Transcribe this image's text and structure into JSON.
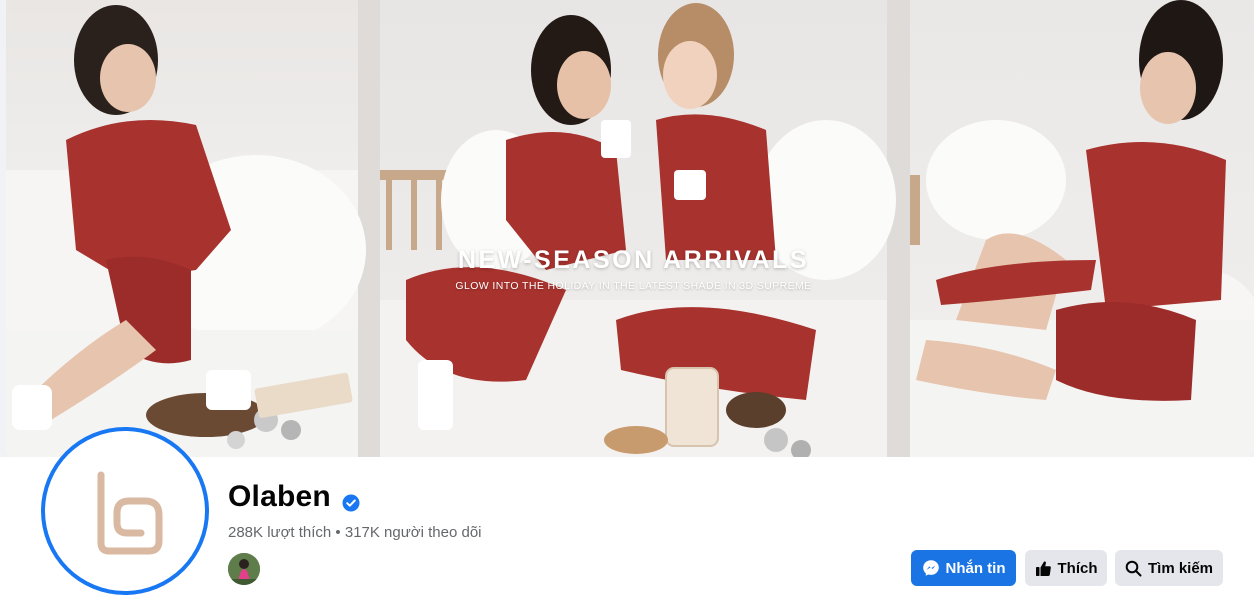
{
  "cover": {
    "headline": "NEW-SEASON ARRIVALS",
    "subheadline": "GLOW INTO THE HOLIDAY IN THE LATEST SHADE IN 3D SUPREME"
  },
  "page": {
    "name": "Olaben",
    "verified": true,
    "stats": "288K lượt thích • 317K người theo dõi"
  },
  "actions": {
    "message_label": "Nhắn tin",
    "like_label": "Thích",
    "search_label": "Tìm kiếm"
  },
  "colors": {
    "accent": "#1877f2",
    "button_primary": "#1b74e4",
    "button_secondary": "#e4e6eb",
    "logo": "#d9b9a1",
    "outfit": "#a8322e"
  },
  "icons": {
    "message": "messenger-icon",
    "like": "thumbs-up-icon",
    "search": "search-icon",
    "verified": "verified-badge-icon"
  }
}
